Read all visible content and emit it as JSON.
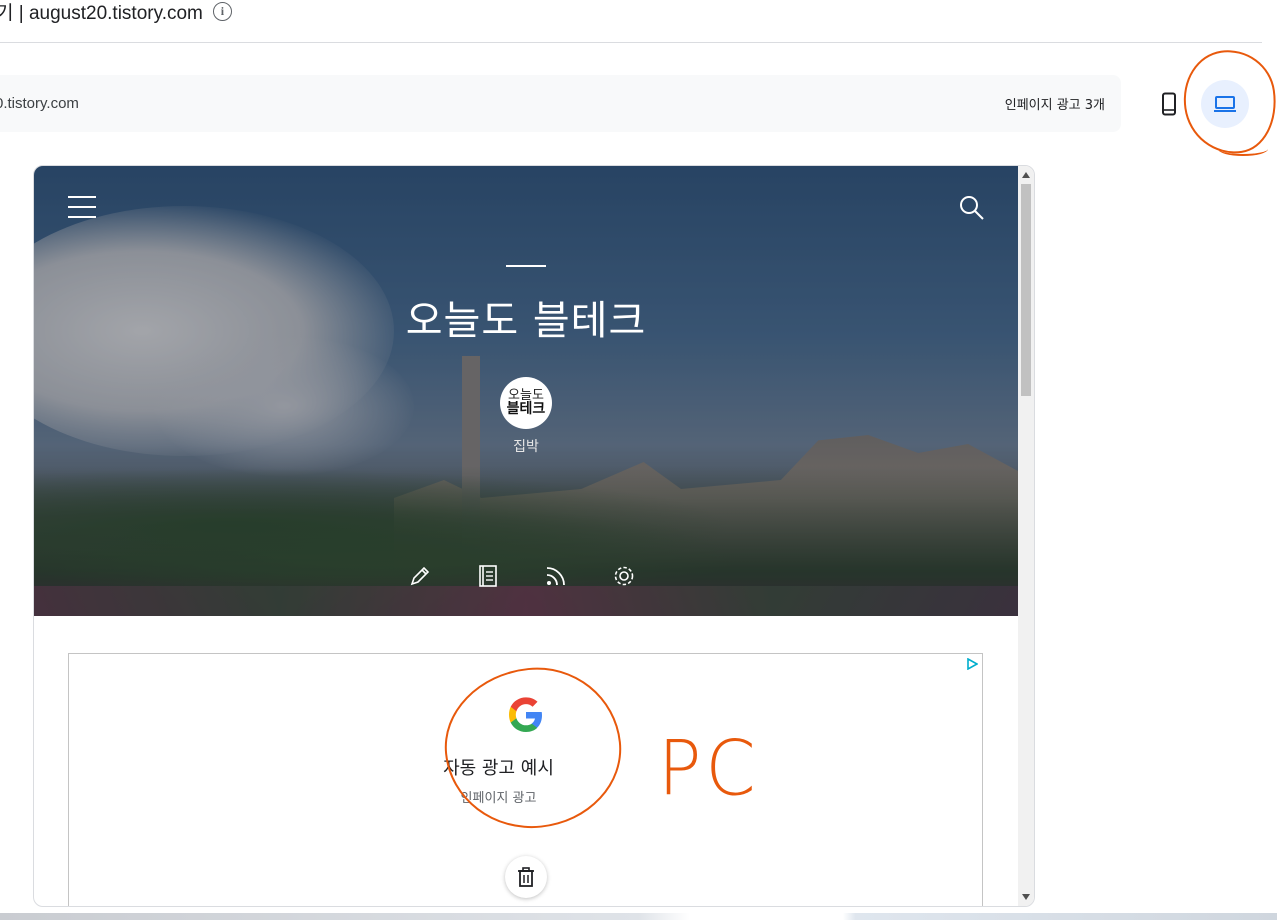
{
  "header": {
    "title": "기 | august20.tistory.com"
  },
  "url_bar": {
    "url": "0.tistory.com",
    "ad_count": "인페이지 광고 3개"
  },
  "devices": {
    "mobile_icon": "smartphone-icon",
    "desktop_icon": "laptop-icon",
    "selected": "desktop"
  },
  "preview": {
    "blog_title": "오늘도 블테크",
    "avatar_line1": "오늘도",
    "avatar_line2": "블테크",
    "author": "집박",
    "tools": [
      "pencil-icon",
      "book-icon",
      "rss-icon",
      "gear-icon"
    ]
  },
  "ad": {
    "title": "자동 광고 예시",
    "subtitle": "인페이지 광고"
  },
  "annotation": {
    "text": "PC",
    "color": "#e8590c"
  },
  "colors": {
    "accent": "#1a73e8",
    "selected_bg": "#e8f0fe",
    "annotation": "#e8590c"
  }
}
